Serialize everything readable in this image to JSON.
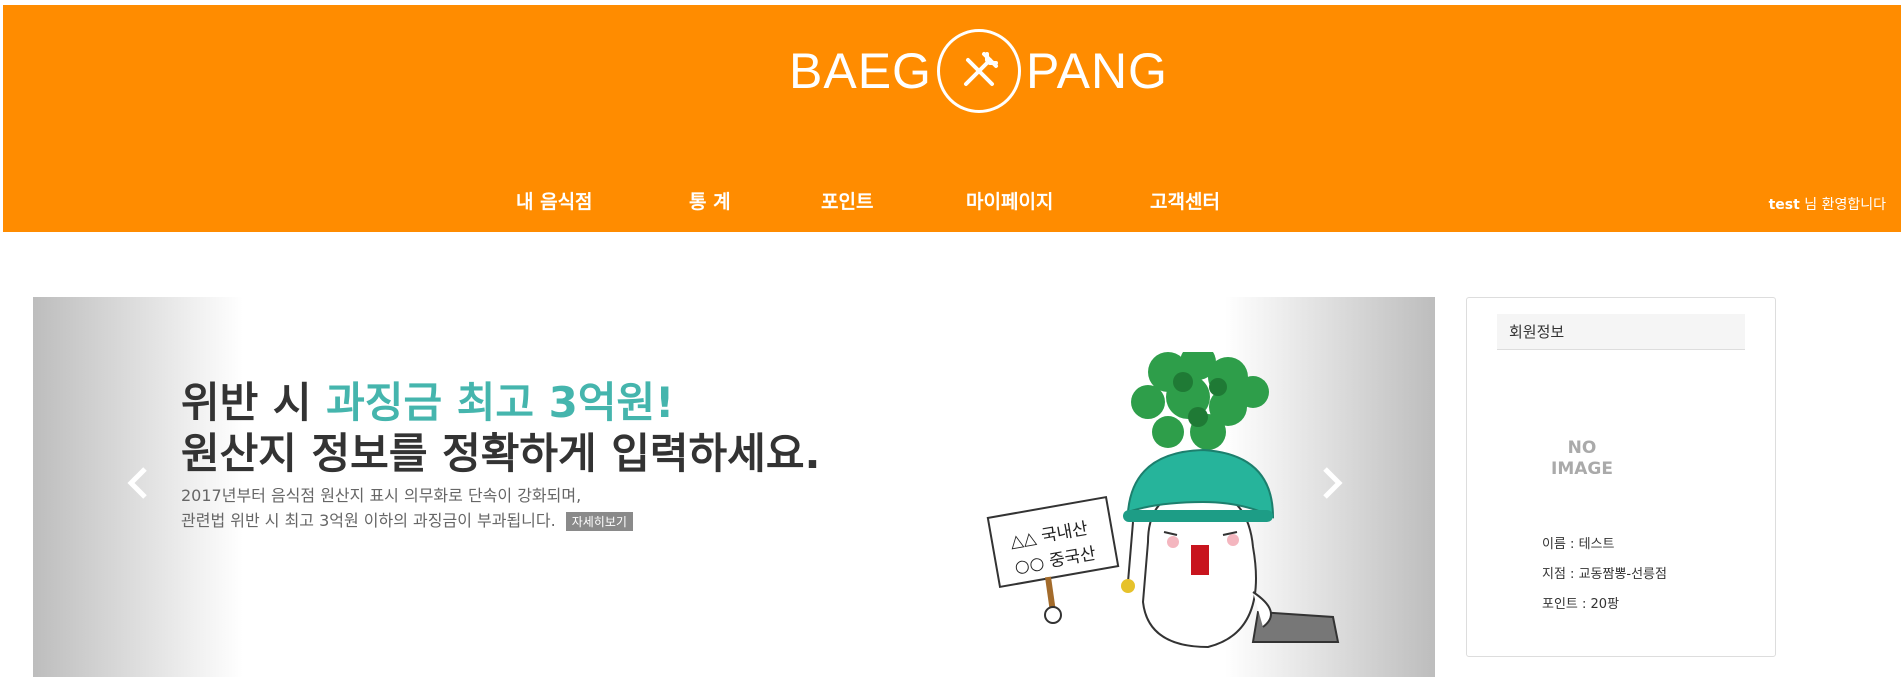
{
  "brand": {
    "left": "BAEG",
    "right": "PANG",
    "logo_icon": "fork-knife-icon"
  },
  "nav": {
    "items": [
      "내 음식점",
      "통 계",
      "포인트",
      "마이페이지",
      "고객센터"
    ]
  },
  "user": {
    "name": "test",
    "welcome_suffix": " 님 환영합니다"
  },
  "banner": {
    "line1_prefix": "위반 시 ",
    "line1_accent": "과징금 최고 3억원!",
    "line2": "원산지 정보를 정확하게 입력하세요.",
    "desc1": "2017년부터 음식점 원산지 표시 의무화로 단속이 강화되며,",
    "desc2": "관련법 위반 시 최고 3억원 이하의 과징금이 부과됩니다.",
    "detail_label": "자세히보기",
    "sign_line1": "△△ 국내산",
    "sign_line2": "○○ 중국산",
    "prev_icon": "chevron-left-icon",
    "next_icon": "chevron-right-icon",
    "accent_color": "#45b5ad"
  },
  "member": {
    "title": "회원정보",
    "noimage_line1": "NO",
    "noimage_line2": "IMAGE",
    "name_label": "이름 : 테스트",
    "branch_label": "지점 : 교동짬뽕-선릉점",
    "points_label": "포인트 : 20팡"
  },
  "colors": {
    "brand_orange": "#ff8c00"
  }
}
